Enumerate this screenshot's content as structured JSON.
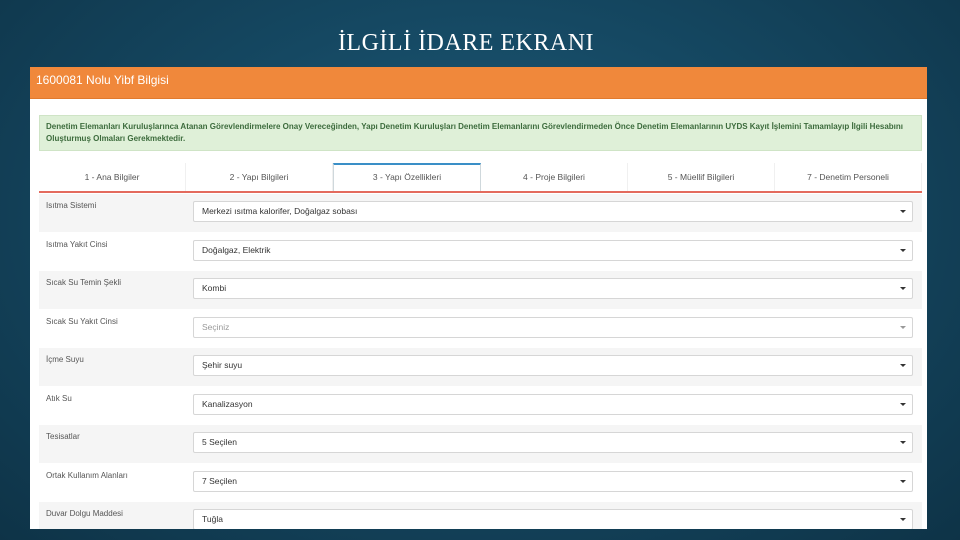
{
  "slide": {
    "title": "İLGİLİ İDARE EKRANI"
  },
  "panel": {
    "header": "1600081 Nolu Yibf Bilgisi",
    "alert": "Denetim Elemanları Kuruluşlarınca Atanan Görevlendirmelere Onay Vereceğinden, Yapı Denetim Kuruluşları Denetim Elemanlarını Görevlendirmeden Önce Denetim Elemanlarının UYDS Kayıt İşlemini Tamamlayıp İlgili Hesabını Oluşturmuş Olmaları Gerekmektedir."
  },
  "tabs": [
    {
      "label": "1 - Ana Bilgiler",
      "active": false
    },
    {
      "label": "2 - Yapı Bilgileri",
      "active": false
    },
    {
      "label": "3 - Yapı Özellikleri",
      "active": true
    },
    {
      "label": "4 - Proje Bilgileri",
      "active": false
    },
    {
      "label": "5 - Müellif Bilgileri",
      "active": false
    },
    {
      "label": "7 - Denetim Personeli",
      "active": false
    }
  ],
  "fields": [
    {
      "label": "Isıtma Sistemi",
      "value": "Merkezi ısıtma kalorifer, Doğalgaz sobası",
      "placeholder": false
    },
    {
      "label": "Isıtma Yakıt Cinsi",
      "value": "Doğalgaz, Elektrik",
      "placeholder": false
    },
    {
      "label": "Sıcak Su Temin Şekli",
      "value": "Kombi",
      "placeholder": false
    },
    {
      "label": "Sıcak Su Yakıt Cinsi",
      "value": "Seçiniz",
      "placeholder": true
    },
    {
      "label": "İçme Suyu",
      "value": "Şehir suyu",
      "placeholder": false
    },
    {
      "label": "Atık Su",
      "value": "Kanalizasyon",
      "placeholder": false
    },
    {
      "label": "Tesisatlar",
      "value": "5 Seçilen",
      "placeholder": false
    },
    {
      "label": "Ortak Kullanım Alanları",
      "value": "7 Seçilen",
      "placeholder": false
    },
    {
      "label": "Duvar Dolgu Maddesi",
      "value": "Tuğla",
      "placeholder": false
    }
  ]
}
